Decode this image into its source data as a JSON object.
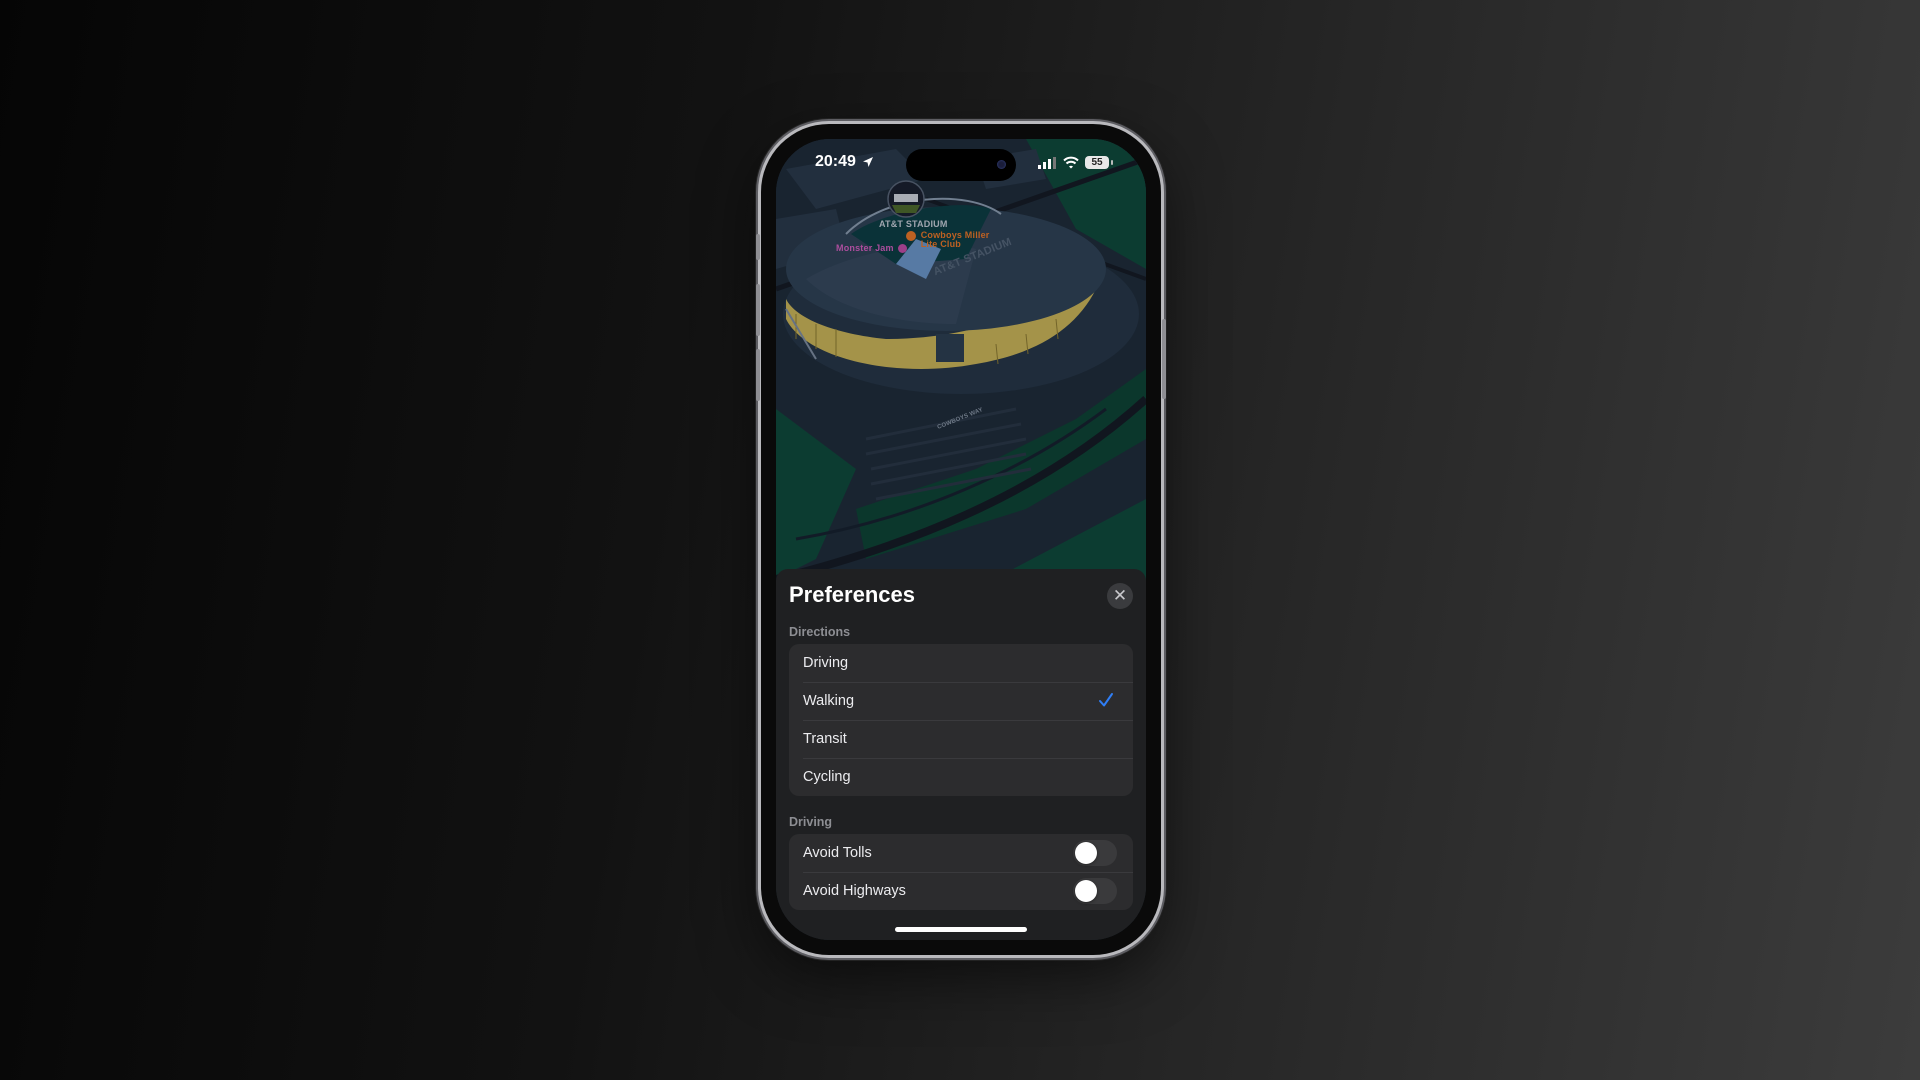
{
  "status_bar": {
    "time": "20:49",
    "battery_level": "55",
    "icons": [
      "location-arrow-icon",
      "cellular-signal-icon",
      "wifi-icon",
      "battery-icon"
    ]
  },
  "map": {
    "place_title": "AT&T STADIUM",
    "pois": [
      {
        "name": "Monster Jam",
        "color": "#d25fc0",
        "icon": "ticket-icon"
      },
      {
        "name": "Cowboys Miller Lite Club",
        "line1": "Cowboys Miller",
        "line2": "Lite Club",
        "color": "#e8772a",
        "icon": "cocktail-icon"
      }
    ],
    "building_label": "AT&T STADIUM",
    "road_label": "COWBOYS WAY"
  },
  "sheet": {
    "title": "Preferences",
    "close_label": "✕",
    "directions": {
      "header": "Directions",
      "options": [
        {
          "label": "Driving",
          "selected": false
        },
        {
          "label": "Walking",
          "selected": true
        },
        {
          "label": "Transit",
          "selected": false
        },
        {
          "label": "Cycling",
          "selected": false
        }
      ]
    },
    "driving": {
      "header": "Driving",
      "toggles": [
        {
          "label": "Avoid Tolls",
          "on": false
        },
        {
          "label": "Avoid Highways",
          "on": false
        }
      ]
    }
  },
  "colors": {
    "accent": "#2f7ef5",
    "sheet_bg": "#1f2022",
    "group_bg": "#2c2c2e"
  }
}
